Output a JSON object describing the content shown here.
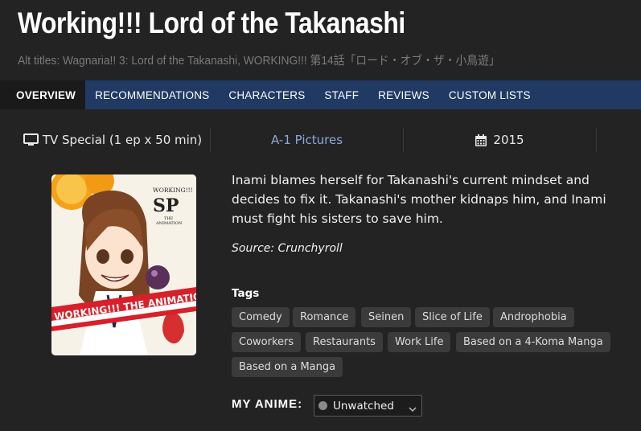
{
  "header": {
    "title": "Working!!! Lord of the Takanashi",
    "alt_titles": "Alt titles: Wagnaria!! 3: Lord of the Takanashi, WORKING!!! 第14話「ロード・オブ・ザ・小鳥遊」"
  },
  "nav": {
    "tabs": [
      {
        "label": "OVERVIEW",
        "active": true
      },
      {
        "label": "RECOMMENDATIONS"
      },
      {
        "label": "CHARACTERS"
      },
      {
        "label": "STAFF"
      },
      {
        "label": "REVIEWS"
      },
      {
        "label": "CUSTOM LISTS"
      }
    ]
  },
  "info": {
    "type": "TV Special (1 ep x 50 min)",
    "type_icon": "tv-icon",
    "studio": "A-1 Pictures",
    "year": "2015",
    "year_icon": "calendar-icon"
  },
  "cover": {
    "brand_line1": "WORKING!!!",
    "brand_line2": "SP",
    "brand_line3": "THE",
    "brand_line4": "ANIMATION",
    "band_text": "WORKING!!! THE ANIMATION WOR"
  },
  "synopsis": {
    "text": "Inami blames herself for Takanashi's current mindset and decides to fix it. Takanashi's mother kidnaps him, and Inami must fight his sisters to save him.",
    "source": "Source: Crunchyroll"
  },
  "tags": {
    "label": "Tags",
    "items": [
      "Comedy",
      "Romance",
      "Seinen",
      "Slice of Life",
      "Androphobia",
      "Coworkers",
      "Restaurants",
      "Work Life",
      "Based on a 4-Koma Manga",
      "Based on a Manga"
    ]
  },
  "my_anime": {
    "label": "MY ANIME:",
    "status": "Unwatched",
    "status_color": "#8a8a8a"
  },
  "colors": {
    "background": "#232323",
    "nav_bar": "#213a63",
    "studio_link": "#8ea8d8",
    "tag_bg": "#3b3b3b"
  }
}
